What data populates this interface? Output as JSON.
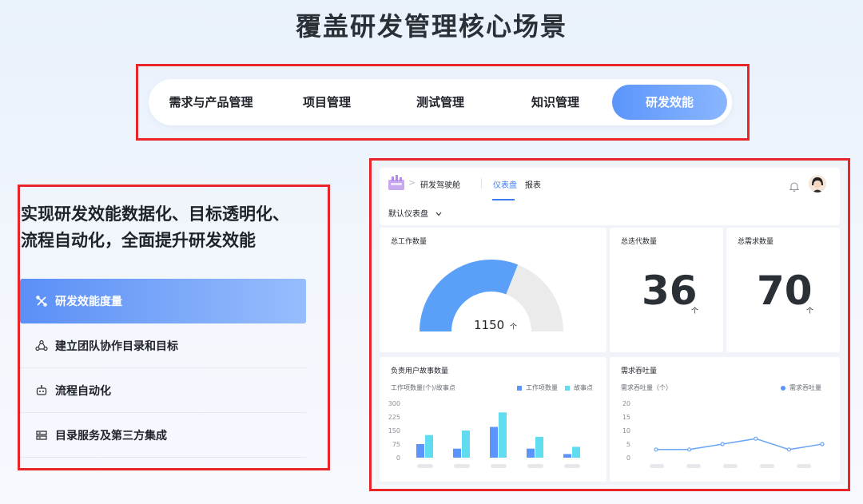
{
  "page": {
    "title": "覆盖研发管理核心场景"
  },
  "tabs": [
    {
      "label": "需求与产品管理"
    },
    {
      "label": "项目管理"
    },
    {
      "label": "测试管理"
    },
    {
      "label": "知识管理"
    },
    {
      "label": "研发效能",
      "active": true
    }
  ],
  "left": {
    "heading_line1": "实现研发效能数据化、目标透明化、",
    "heading_line2": "流程自动化，全面提升研发效能",
    "features": [
      {
        "label": "研发效能度量",
        "icon": "tools-icon",
        "active": true
      },
      {
        "label": "建立团队协作目录和目标",
        "icon": "team-icon"
      },
      {
        "label": "流程自动化",
        "icon": "robot-icon"
      },
      {
        "label": "目录服务及第三方集成",
        "icon": "server-icon"
      }
    ]
  },
  "dashboard": {
    "breadcrumb": "研发驾驶舱",
    "tabs": [
      {
        "label": "仪表盘",
        "active": true
      },
      {
        "label": "报表"
      }
    ],
    "selector": "默认仪表盘",
    "cards": {
      "total_work": {
        "title": "总工作数量",
        "value": "1150",
        "unit": "个",
        "gauge_fraction": 0.62
      },
      "iterations": {
        "title": "总迭代数量",
        "value": "36",
        "unit": "个"
      },
      "requirements": {
        "title": "总需求数量",
        "value": "70",
        "unit": "个"
      }
    },
    "colors": {
      "accent": "#3c7bf6",
      "bar_work": "#5b95fb",
      "bar_story": "#5fdcef",
      "line": "#6aa6f5",
      "gauge_fill": "#5a9ff8",
      "gauge_rest": "#ebebeb"
    }
  },
  "chart_data": [
    {
      "type": "bar",
      "title": "负责用户故事数量",
      "ylabel": "工作项数量(个)/故事点",
      "ylim": [
        0,
        300
      ],
      "yticks": [
        "300",
        "225",
        "150",
        "75",
        "0"
      ],
      "categories": [
        "",
        "",
        "",
        "",
        ""
      ],
      "series": [
        {
          "name": "工作项数量",
          "values": [
            75,
            50,
            170,
            50,
            20
          ]
        },
        {
          "name": "故事点",
          "values": [
            125,
            150,
            250,
            115,
            60
          ]
        }
      ],
      "legend": "top-right"
    },
    {
      "type": "line",
      "title": "需求吞吐量",
      "ylabel": "需求吞吐量（个）",
      "ylim": [
        0,
        20
      ],
      "yticks": [
        "20",
        "15",
        "10",
        "5",
        "0"
      ],
      "categories": [
        "",
        "",
        "",
        "",
        "",
        ""
      ],
      "series": [
        {
          "name": "需求吞吐量",
          "values": [
            3,
            3,
            5,
            7,
            3,
            5
          ]
        }
      ],
      "legend": "top-right"
    }
  ]
}
